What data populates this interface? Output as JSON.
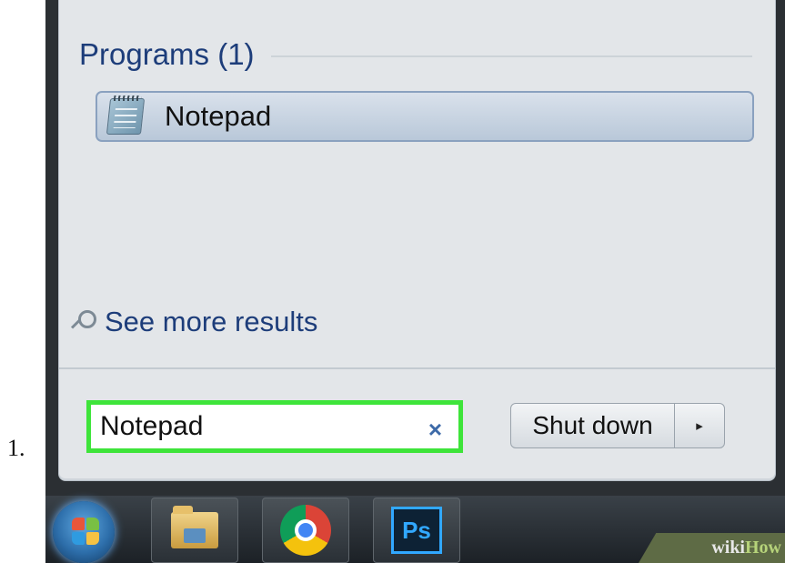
{
  "step": {
    "number": "1."
  },
  "start_menu": {
    "section_title": "Programs (1)",
    "results": [
      {
        "label": "Notepad",
        "icon": "notepad-icon"
      }
    ],
    "see_more_label": "See more results",
    "search": {
      "value": "Notepad",
      "clear_glyph": "×"
    },
    "shutdown": {
      "label": "Shut down",
      "arrow_glyph": "▸"
    }
  },
  "taskbar": {
    "items": [
      {
        "name": "start-button",
        "icon": "windows-logo-icon"
      },
      {
        "name": "file-explorer",
        "icon": "folder-icon"
      },
      {
        "name": "google-chrome",
        "icon": "chrome-icon"
      },
      {
        "name": "photoshop",
        "icon": "photoshop-icon",
        "label": "Ps"
      }
    ]
  },
  "watermark": {
    "part1": "wiki",
    "part2": "How"
  },
  "colors": {
    "search_highlight": "#3ee43a",
    "menu_text_blue": "#1d3d7a",
    "menu_background": "#e3e6e9"
  }
}
